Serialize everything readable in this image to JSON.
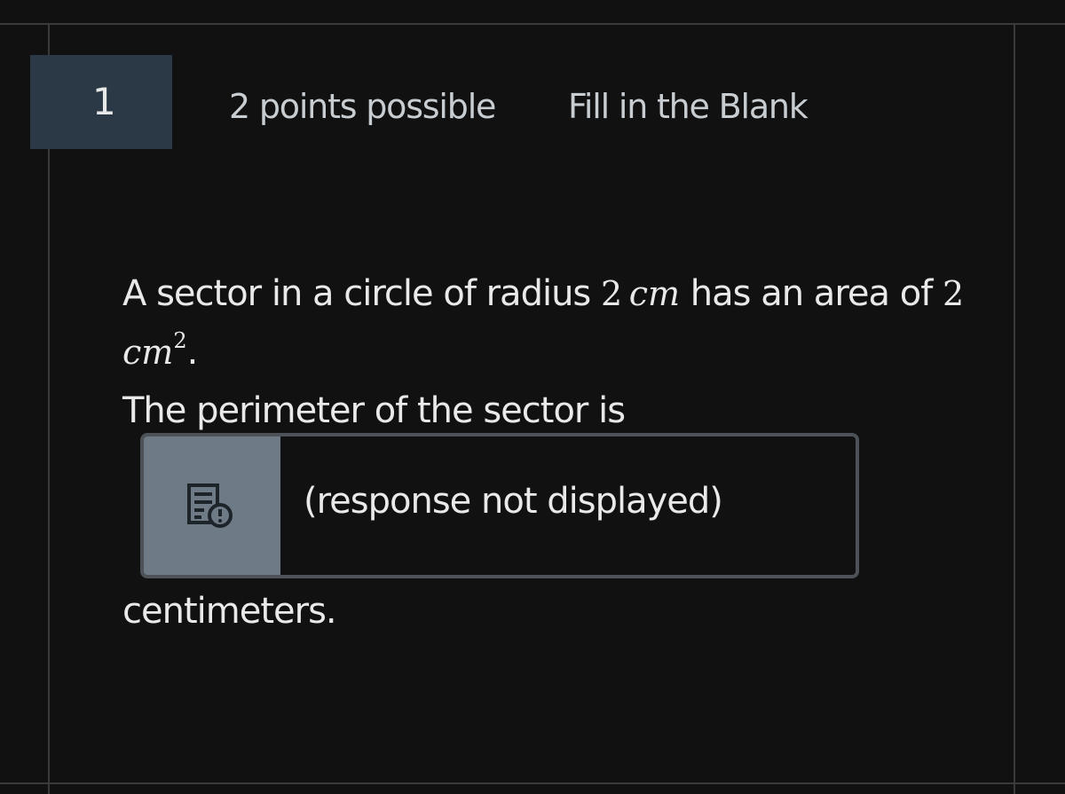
{
  "question": {
    "number": "1",
    "points": "2 points possible",
    "type": "Fill in the Blank",
    "text_part1": "A sector in a circle of radius ",
    "radius_value": "2",
    "radius_unit": "cm",
    "text_part2": " has an area of ",
    "area_value": "2",
    "area_unit": "cm",
    "area_exponent": "2",
    "text_part3": ".",
    "text_part4": "The perimeter of the sector is",
    "response_placeholder": "(response not displayed)",
    "response_icon": "document-alert-icon",
    "text_after": "centimeters."
  }
}
